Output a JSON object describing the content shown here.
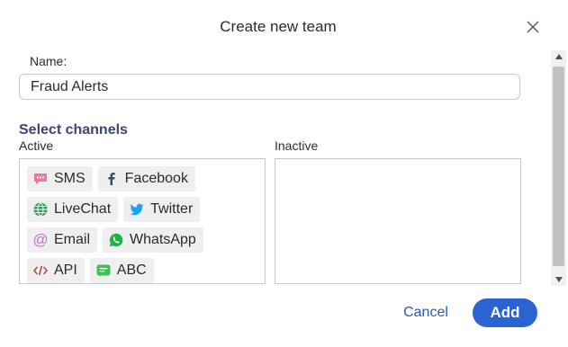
{
  "dialog": {
    "title": "Create new team",
    "close_icon": "close-icon"
  },
  "form": {
    "name_label": "Name:",
    "name_value": "Fraud Alerts",
    "section_title": "Select channels",
    "active_label": "Active",
    "inactive_label": "Inactive"
  },
  "channels": {
    "active": [
      {
        "label": "SMS",
        "icon": "sms-icon",
        "color": "#e879a6"
      },
      {
        "label": "Facebook",
        "icon": "facebook-icon",
        "color": "#3b5998"
      },
      {
        "label": "LiveChat",
        "icon": "globe-icon",
        "color": "#2e9b5a"
      },
      {
        "label": "Twitter",
        "icon": "twitter-icon",
        "color": "#1da1f2"
      },
      {
        "label": "Email",
        "icon": "at-icon",
        "color": "#c970c9"
      },
      {
        "label": "WhatsApp",
        "icon": "whatsapp-icon",
        "color": "#25b14a"
      },
      {
        "label": "API",
        "icon": "code-icon",
        "color": "#b04a3a"
      },
      {
        "label": "ABC",
        "icon": "chat-bubble-icon",
        "color": "#3cc05a"
      }
    ],
    "inactive": []
  },
  "actions": {
    "cancel_label": "Cancel",
    "add_label": "Add"
  },
  "colors": {
    "accent": "#2a64d3",
    "section_title": "#3c4370"
  }
}
